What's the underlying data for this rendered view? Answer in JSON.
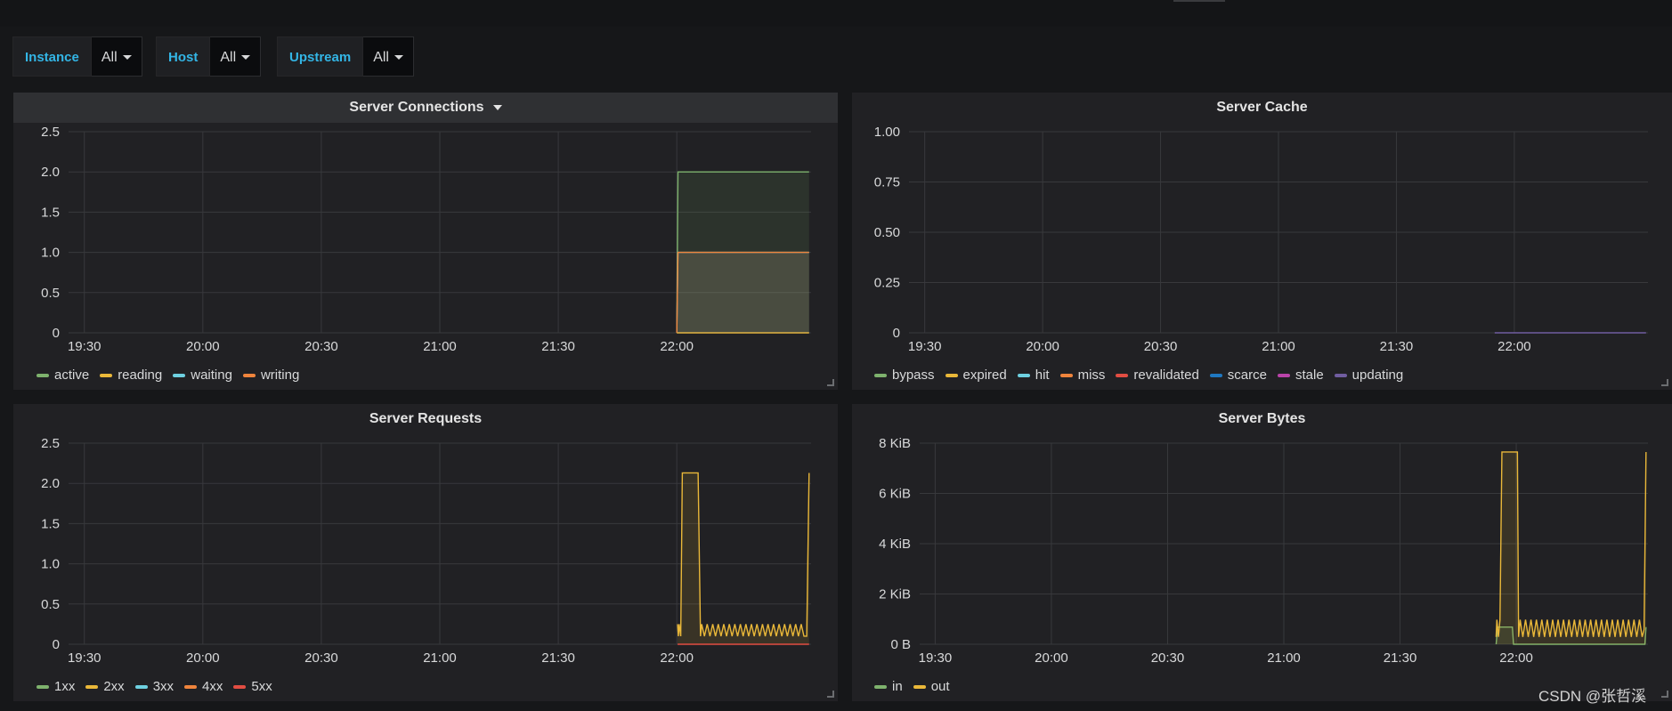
{
  "variables": [
    {
      "label": "Instance",
      "value": "All"
    },
    {
      "label": "Host",
      "value": "All"
    },
    {
      "label": "Upstream",
      "value": "All"
    }
  ],
  "panels": [
    {
      "title": "Server Connections",
      "has_menu_caret": true
    },
    {
      "title": "Server Cache",
      "has_menu_caret": false
    },
    {
      "title": "Server Requests",
      "has_menu_caret": false
    },
    {
      "title": "Server Bytes",
      "has_menu_caret": false
    }
  ],
  "chart_data": [
    {
      "type": "line",
      "title": "Server Connections",
      "x_ticks": [
        "19:30",
        "20:00",
        "20:30",
        "21:00",
        "21:30",
        "22:00"
      ],
      "x_tick_values_min": [
        0,
        30,
        60,
        90,
        120,
        150
      ],
      "x_range_min": [
        -4,
        184
      ],
      "y_tick_labels": [
        "0",
        "0.5",
        "1.0",
        "1.5",
        "2.0",
        "2.5"
      ],
      "ylim": [
        0,
        2.5
      ],
      "grid": true,
      "legend_position": "bottom-left",
      "series": [
        {
          "name": "active",
          "color": "#7eb26d",
          "fill": true,
          "points": [
            [
              150,
              0
            ],
            [
              150.3,
              2
            ],
            [
              183.5,
              2
            ]
          ]
        },
        {
          "name": "reading",
          "color": "#eab839",
          "fill": false,
          "points": [
            [
              150,
              0
            ],
            [
              183.5,
              0
            ]
          ]
        },
        {
          "name": "waiting",
          "color": "#6ed0e0",
          "fill": true,
          "points": [
            [
              150,
              0
            ],
            [
              150.3,
              1
            ],
            [
              183.5,
              1
            ]
          ]
        },
        {
          "name": "writing",
          "color": "#ef843c",
          "fill": true,
          "points": [
            [
              150,
              0
            ],
            [
              150.3,
              1
            ],
            [
              183.5,
              1
            ]
          ]
        }
      ]
    },
    {
      "type": "line",
      "title": "Server Cache",
      "x_ticks": [
        "19:30",
        "20:00",
        "20:30",
        "21:00",
        "21:30",
        "22:00"
      ],
      "x_tick_values_min": [
        0,
        30,
        60,
        90,
        120,
        150
      ],
      "x_range_min": [
        -4,
        184
      ],
      "y_tick_labels": [
        "0",
        "0.25",
        "0.50",
        "0.75",
        "1.00"
      ],
      "ylim": [
        0,
        1
      ],
      "grid": true,
      "legend_position": "bottom-left",
      "series": [
        {
          "name": "bypass",
          "color": "#7eb26d",
          "fill": false,
          "points": []
        },
        {
          "name": "expired",
          "color": "#eab839",
          "fill": false,
          "points": []
        },
        {
          "name": "hit",
          "color": "#6ed0e0",
          "fill": false,
          "points": []
        },
        {
          "name": "miss",
          "color": "#ef843c",
          "fill": false,
          "points": []
        },
        {
          "name": "revalidated",
          "color": "#e24d42",
          "fill": false,
          "points": []
        },
        {
          "name": "scarce",
          "color": "#1f78c1",
          "fill": false,
          "points": []
        },
        {
          "name": "stale",
          "color": "#ba43a9",
          "fill": false,
          "points": []
        },
        {
          "name": "updating",
          "color": "#705da0",
          "fill": false,
          "points": [
            [
              145,
              0
            ],
            [
              183.5,
              0
            ]
          ]
        }
      ]
    },
    {
      "type": "line",
      "title": "Server Requests",
      "x_ticks": [
        "19:30",
        "20:00",
        "20:30",
        "21:00",
        "21:30",
        "22:00"
      ],
      "x_tick_values_min": [
        0,
        30,
        60,
        90,
        120,
        150
      ],
      "x_range_min": [
        -4,
        184
      ],
      "y_tick_labels": [
        "0",
        "0.5",
        "1.0",
        "1.5",
        "2.0",
        "2.5"
      ],
      "ylim": [
        0,
        2.5
      ],
      "grid": true,
      "legend_position": "bottom-left",
      "series": [
        {
          "name": "1xx",
          "color": "#7eb26d",
          "fill": false,
          "points": []
        },
        {
          "name": "2xx",
          "color": "#eab839",
          "fill": true,
          "points": [
            [
              150.2,
              0.25
            ],
            [
              150.4,
              0.1
            ],
            [
              150.6,
              0.25
            ],
            [
              151,
              0.1
            ],
            [
              151.4,
              2.13
            ],
            [
              155.4,
              2.13
            ],
            [
              156,
              0.1
            ],
            [
              156.3,
              0.25
            ],
            [
              157,
              0.1
            ],
            [
              157.7,
              0.25
            ],
            [
              158.4,
              0.1
            ],
            [
              159.1,
              0.25
            ],
            [
              159.8,
              0.1
            ],
            [
              160.5,
              0.25
            ],
            [
              161.2,
              0.1
            ],
            [
              161.9,
              0.25
            ],
            [
              162.6,
              0.1
            ],
            [
              163.3,
              0.25
            ],
            [
              164,
              0.1
            ],
            [
              164.7,
              0.25
            ],
            [
              165.4,
              0.1
            ],
            [
              166.1,
              0.25
            ],
            [
              166.8,
              0.1
            ],
            [
              167.5,
              0.25
            ],
            [
              168.2,
              0.1
            ],
            [
              168.9,
              0.25
            ],
            [
              169.6,
              0.1
            ],
            [
              170.3,
              0.25
            ],
            [
              171,
              0.1
            ],
            [
              171.7,
              0.25
            ],
            [
              172.4,
              0.1
            ],
            [
              173.1,
              0.25
            ],
            [
              173.8,
              0.1
            ],
            [
              174.5,
              0.25
            ],
            [
              175.2,
              0.1
            ],
            [
              175.9,
              0.25
            ],
            [
              176.6,
              0.1
            ],
            [
              177.3,
              0.25
            ],
            [
              178,
              0.1
            ],
            [
              178.7,
              0.25
            ],
            [
              179.4,
              0.1
            ],
            [
              180.1,
              0.25
            ],
            [
              180.8,
              0.1
            ],
            [
              181.5,
              0.25
            ],
            [
              182.2,
              0.1
            ],
            [
              182.9,
              0.1
            ],
            [
              183.5,
              2.13
            ]
          ]
        },
        {
          "name": "3xx",
          "color": "#6ed0e0",
          "fill": false,
          "points": []
        },
        {
          "name": "4xx",
          "color": "#ef843c",
          "fill": false,
          "points": []
        },
        {
          "name": "5xx",
          "color": "#e24d42",
          "fill": false,
          "points": [
            [
              150.2,
              0
            ],
            [
              183.5,
              0
            ]
          ]
        }
      ]
    },
    {
      "type": "line",
      "title": "Server Bytes",
      "x_ticks": [
        "19:30",
        "20:00",
        "20:30",
        "21:00",
        "21:30",
        "22:00"
      ],
      "x_tick_values_min": [
        0,
        30,
        60,
        90,
        120,
        150
      ],
      "x_range_min": [
        -4,
        184
      ],
      "y_tick_labels": [
        "0 B",
        "2 KiB",
        "4 KiB",
        "6 KiB",
        "8 KiB"
      ],
      "ylim": [
        0,
        8192
      ],
      "grid": true,
      "legend_position": "bottom-left",
      "series": [
        {
          "name": "in",
          "color": "#7eb26d",
          "fill": true,
          "points": [
            [
              144.8,
              0
            ],
            [
              145.2,
              700
            ],
            [
              149,
              700
            ],
            [
              149.3,
              0
            ],
            [
              183.2,
              0
            ],
            [
              183.5,
              700
            ]
          ]
        },
        {
          "name": "out",
          "color": "#eab839",
          "fill": true,
          "points": [
            [
              144.8,
              300
            ],
            [
              145,
              1000
            ],
            [
              145.4,
              300
            ],
            [
              145.8,
              1000
            ],
            [
              146.3,
              7830
            ],
            [
              150.3,
              7830
            ],
            [
              150.6,
              300
            ],
            [
              151,
              1000
            ],
            [
              151.7,
              300
            ],
            [
              152.4,
              1000
            ],
            [
              153.1,
              300
            ],
            [
              153.8,
              1000
            ],
            [
              154.5,
              300
            ],
            [
              155.2,
              1000
            ],
            [
              155.9,
              300
            ],
            [
              156.6,
              1000
            ],
            [
              157.3,
              300
            ],
            [
              158,
              1000
            ],
            [
              158.7,
              300
            ],
            [
              159.4,
              1000
            ],
            [
              160.1,
              300
            ],
            [
              160.8,
              1000
            ],
            [
              161.5,
              300
            ],
            [
              162.2,
              1000
            ],
            [
              162.9,
              300
            ],
            [
              163.6,
              1000
            ],
            [
              164.3,
              300
            ],
            [
              165,
              1000
            ],
            [
              165.7,
              300
            ],
            [
              166.4,
              1000
            ],
            [
              167.1,
              300
            ],
            [
              167.8,
              1000
            ],
            [
              168.5,
              300
            ],
            [
              169.2,
              1000
            ],
            [
              169.9,
              300
            ],
            [
              170.6,
              1000
            ],
            [
              171.3,
              300
            ],
            [
              172,
              1000
            ],
            [
              172.7,
              300
            ],
            [
              173.4,
              1000
            ],
            [
              174.1,
              300
            ],
            [
              174.8,
              1000
            ],
            [
              175.5,
              300
            ],
            [
              176.2,
              1000
            ],
            [
              176.9,
              300
            ],
            [
              177.6,
              1000
            ],
            [
              178.3,
              300
            ],
            [
              179,
              1000
            ],
            [
              179.7,
              300
            ],
            [
              180.4,
              1000
            ],
            [
              181.1,
              300
            ],
            [
              181.8,
              1000
            ],
            [
              182.5,
              300
            ],
            [
              183,
              600
            ],
            [
              183.5,
              7830
            ]
          ]
        }
      ]
    }
  ],
  "watermark": "CSDN @张哲溪"
}
